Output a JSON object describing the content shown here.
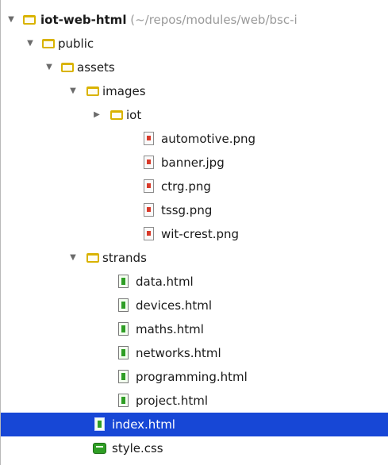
{
  "tree": {
    "root": {
      "label": "iot-web-html",
      "path": " (~/repos/modules/web/bsc-i"
    },
    "public": {
      "label": "public"
    },
    "assets": {
      "label": "assets"
    },
    "images": {
      "label": "images"
    },
    "iot": {
      "label": "iot"
    },
    "image_files": [
      {
        "label": "automotive.png"
      },
      {
        "label": "banner.jpg"
      },
      {
        "label": "ctrg.png"
      },
      {
        "label": "tssg.png"
      },
      {
        "label": "wit-crest.png"
      }
    ],
    "strands": {
      "label": "strands"
    },
    "strand_files": [
      {
        "label": "data.html"
      },
      {
        "label": "devices.html"
      },
      {
        "label": "maths.html"
      },
      {
        "label": "networks.html"
      },
      {
        "label": "programming.html"
      },
      {
        "label": "project.html"
      }
    ],
    "index": {
      "label": "index.html",
      "selected": true
    },
    "style": {
      "label": "style.css"
    }
  },
  "colors": {
    "selection": "#1747d6",
    "folder": "#d9b300",
    "html_icon": "#2f9e25",
    "image_icon": "#d83a2a"
  },
  "icons": {
    "expanded": "▼",
    "collapsed": "▶",
    "folder": "folder-icon",
    "image_file": "image-file-icon",
    "html_file": "html-file-icon",
    "css_file": "css-file-icon"
  }
}
